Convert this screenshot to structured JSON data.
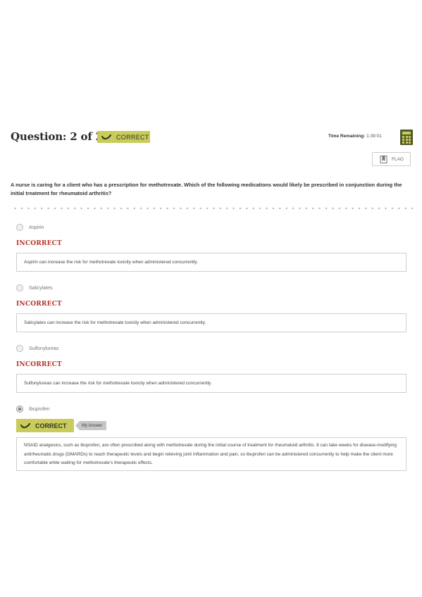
{
  "header": {
    "question_counter": "Question: 2 of 25",
    "status_badge": "CORRECT",
    "time_label": "Time Remaining:",
    "time_value": "1:39:01",
    "flag_label": "FLAG"
  },
  "question": {
    "text": "A nurse is caring for a client who has a prescription for methotrexate. Which of the following medications would likely be prescribed in conjunction during the initial treatment for rheumatoid arthritis?"
  },
  "options": [
    {
      "label": "Aspirin",
      "result": "INCORRECT",
      "feedback": "Aspirin can increase the risk for methotrexate toxicity when administered concurrently."
    },
    {
      "label": "Salicylates",
      "result": "INCORRECT",
      "feedback": "Salicylates can increase the risk for methotrexate toxicity when administered concurrently."
    },
    {
      "label": "Sulfonylureas",
      "result": "INCORRECT",
      "feedback": "Sulfonylureas can increase the risk for methotrexate toxicity when administered concurrently."
    },
    {
      "label": "Ibuprofen",
      "result": "CORRECT",
      "my_answer": "My Answer",
      "feedback": "NSAID analgesics, such as ibuprofen, are often prescribed along with methotrexate during the initial course of treatment for rheumatoid arthritis. It can take weeks for disease-modifying antirheumatic drugs (DMARDs) to reach therapeutic levels and begin relieving joint inflammation and pain, so ibuprofen can be administered concurrently to help make the client more comfortable while waiting for methotrexate's therapeutic effects."
    }
  ],
  "colors": {
    "correct_badge": "#c9cc5b",
    "incorrect_text": "#b5332b",
    "calculator": "#4f5a2a"
  },
  "icons": [
    "checkmark-icon",
    "calculator-icon",
    "flag-icon"
  ]
}
